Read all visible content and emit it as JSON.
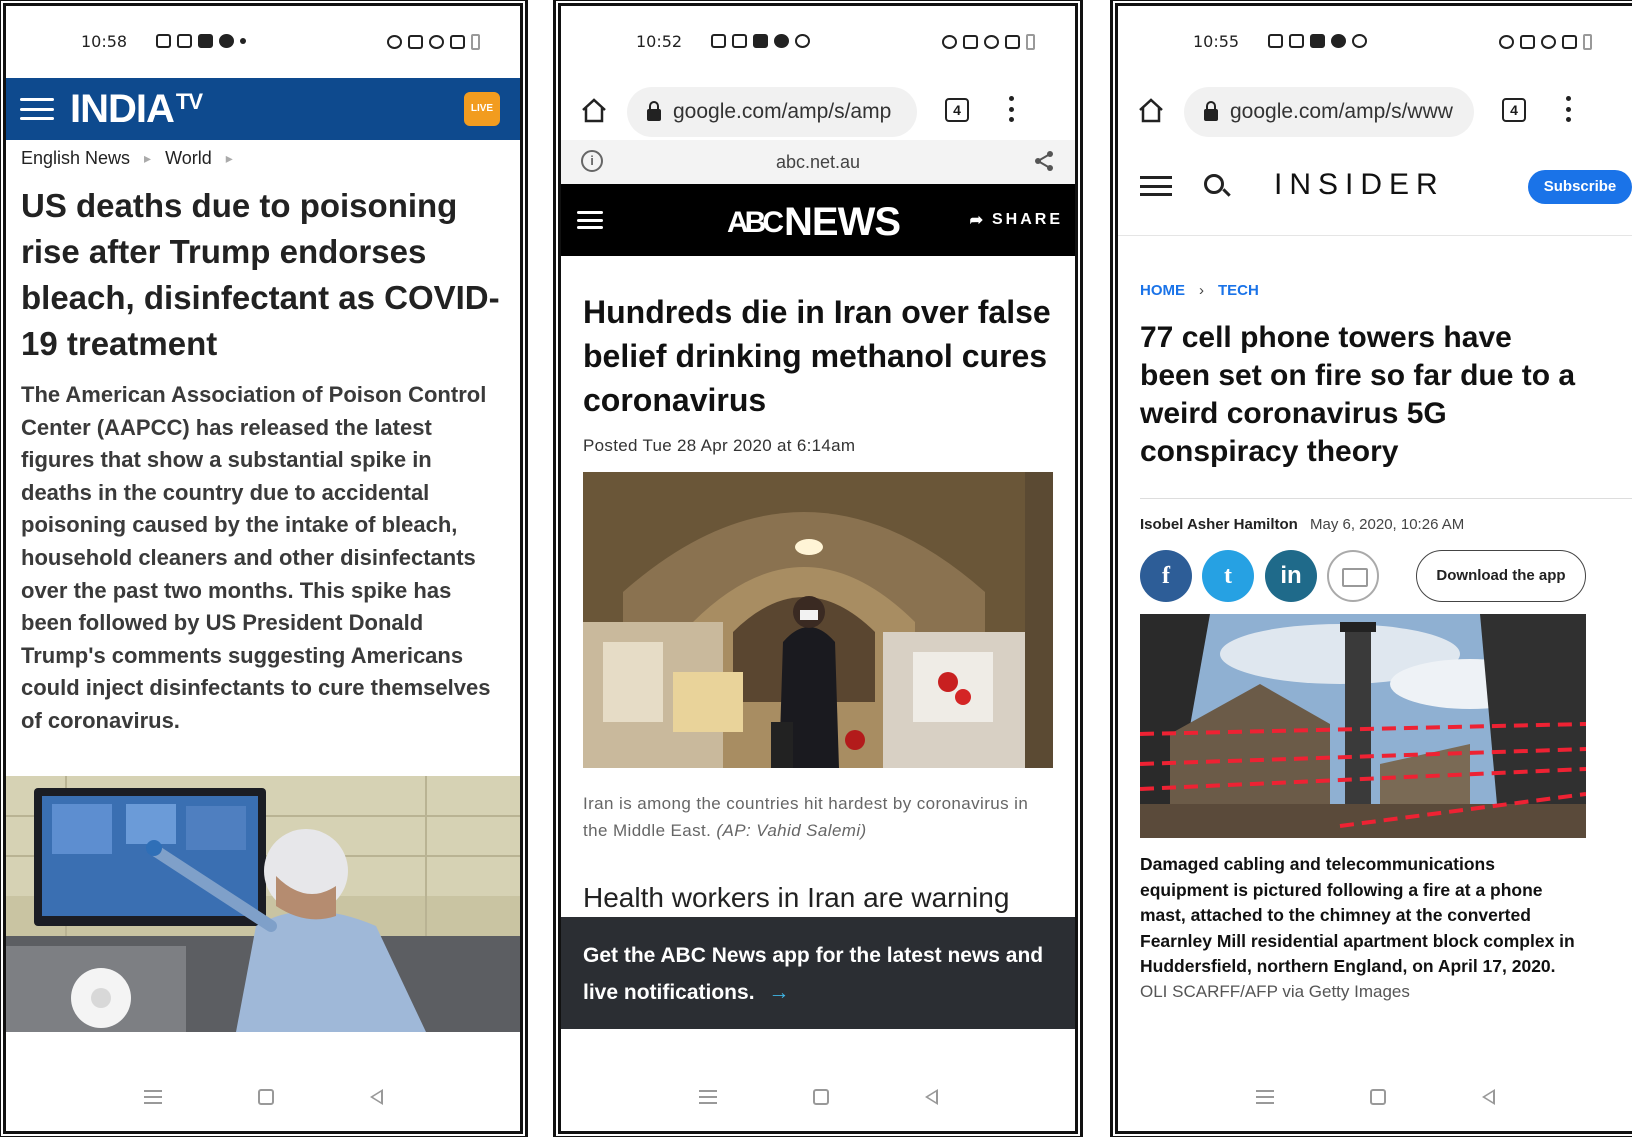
{
  "phone1": {
    "status_time": "10:58",
    "site": "INDIA TV",
    "logo_text": "INDIA",
    "logo_suffix": "TV",
    "live_label": "LIVE",
    "breadcrumb": [
      "English News",
      "World"
    ],
    "title": "US deaths due to poisoning rise after Trump endorses bleach, disinfectant as COVID-19 treatment",
    "body": "The American Association of Poison Control Center (AAPCC) has released the latest figures that show a substantial spike in deaths in the country due to accidental poisoning caused by the intake of bleach, household cleaners and other disinfectants over the past two months. This spike has been followed by US President Donald Trump's comments suggesting Americans could inject disinfectants to cure themselves of coronavirus."
  },
  "phone2": {
    "status_time": "10:52",
    "url": "google.com/amp/s/amp",
    "tab_count": "4",
    "domain": "abc.net.au",
    "logo_mark": "ABC",
    "logo_text": "NEWS",
    "share_label": "SHARE",
    "title": "Hundreds die in Iran over false belief drinking methanol cures coronavirus",
    "posted": "Posted Tue 28 Apr 2020 at 6:14am",
    "caption": "Iran is among the countries hit hardest by coronavirus in the Middle East.",
    "caption_credit": "(AP: Vahid Salemi)",
    "lead": "Health workers in Iran are warning",
    "banner": "Get the ABC News app for the latest news and live notifications.",
    "banner_arrow": "→"
  },
  "phone3": {
    "status_time": "10:55",
    "url": "google.com/amp/s/www",
    "tab_count": "4",
    "logo": "INSIDER",
    "subscribe": "Subscribe",
    "breadcrumb": [
      "HOME",
      "TECH"
    ],
    "title": "77 cell phone towers have been set on fire so far due to a weird coronavirus 5G conspiracy theory",
    "author": "Isobel Asher Hamilton",
    "date": "May 6, 2020, 10:26 AM",
    "social": [
      "f",
      "t",
      "in"
    ],
    "download": "Download the app",
    "caption": "Damaged cabling and telecommunications equipment is pictured following a fire at a phone mast, attached to the chimney at the converted Fearnley Mill residential apartment block complex in Huddersfield, northern England, on April 17, 2020.",
    "credit": "OLI SCARFF/AFP via Getty Images"
  }
}
